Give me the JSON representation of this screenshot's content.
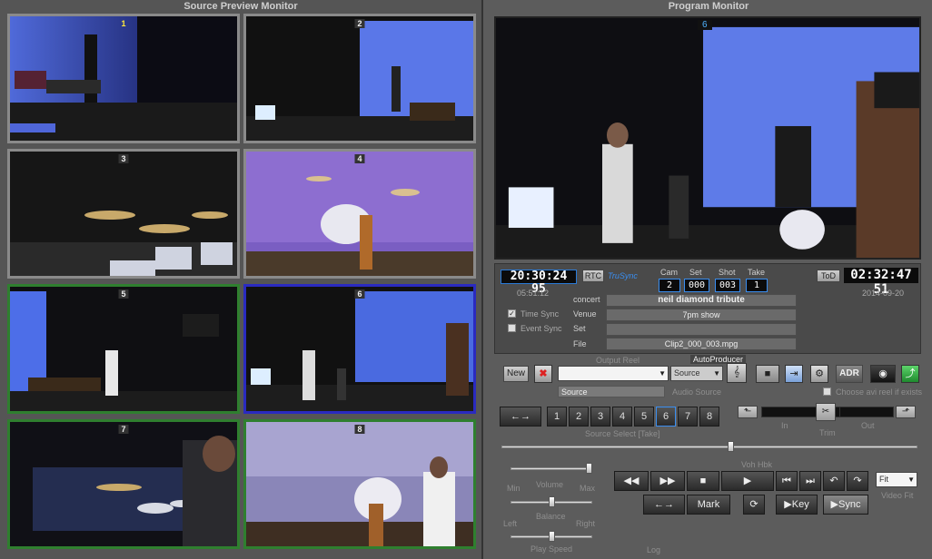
{
  "source_panel": {
    "title": "Source Preview Monitor",
    "tiles": [
      {
        "num": "1",
        "border": "grey"
      },
      {
        "num": "2",
        "border": "grey"
      },
      {
        "num": "3",
        "border": "grey"
      },
      {
        "num": "4",
        "border": "grey"
      },
      {
        "num": "5",
        "border": "green"
      },
      {
        "num": "6",
        "border": "blue"
      },
      {
        "num": "7",
        "border": "green"
      },
      {
        "num": "8",
        "border": "green"
      }
    ]
  },
  "program_panel": {
    "title": "Program Monitor",
    "cam_badge": "6"
  },
  "info": {
    "timecode": "20:30:24 95",
    "rtc": "RTC",
    "trusync": "TruSync",
    "cam_label": "Cam",
    "cam_value": "2",
    "set_label": "Set",
    "set_value": "000",
    "shot_label": "Shot",
    "shot_value": "003",
    "take_label": "Take",
    "take_value": "1",
    "tod_label": "ToD",
    "clock": "02:32:47 51",
    "sub_time": "05:51:12",
    "date": "2014-09-20",
    "time_sync_label": "Time Sync",
    "event_sync_label": "Event Sync",
    "concert_label": "concert",
    "concert_value": "neil diamond tribute",
    "venue_label": "Venue",
    "venue_value": "7pm show",
    "set_row_label": "Set",
    "set_row_value": "",
    "file_label": "File",
    "file_value": "Clip2_000_003.mpg"
  },
  "controls": {
    "output_reel_label": "Output Reel",
    "autoproducer_label": "AutoProducer",
    "new_label": "New",
    "delete_icon": "x-icon",
    "reel_value": "",
    "source_combo": "Source",
    "source_field": "Source",
    "audio_source_label": "Audio Source",
    "adr_label": "ADR",
    "choose_avi_label": "Choose avi reel if exists",
    "source_select_label": "Source Select [Take]",
    "source_buttons": [
      "1",
      "2",
      "3",
      "4",
      "5",
      "6",
      "7",
      "8"
    ],
    "active_source": "6",
    "in_label": "In",
    "trim_label": "Trim",
    "out_label": "Out",
    "voh_label": "Voh Hbk",
    "volume_label": "Volume",
    "min_label": "Min",
    "max_label": "Max",
    "balance_label": "Balance",
    "left_label": "Left",
    "right_label": "Right",
    "play_speed_label": "Play Speed",
    "mark_label": "Mark",
    "key_label": "Key",
    "sync_label": "Sync",
    "video_fit_label": "Video Fit",
    "video_fit_value": "Fit",
    "log_label": "Log",
    "program_slider": 0.55,
    "volume_level": 0.95,
    "balance_level": 0.5,
    "play_speed_level": 0.5
  }
}
